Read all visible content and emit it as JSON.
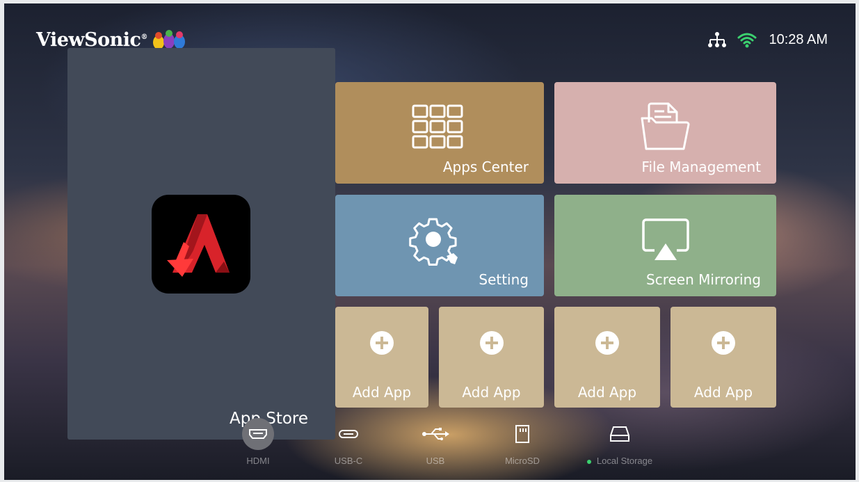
{
  "brand": {
    "logo_text": "ViewSonic",
    "registered": "®"
  },
  "status_bar": {
    "network_icon": "network-icon",
    "wifi_icon": "wifi-icon",
    "time": "10:28 AM",
    "accent_color": "#3bd16f"
  },
  "preview_panel": {
    "app_icon": "app-store-icon",
    "title": "App Store"
  },
  "tiles": {
    "apps_center": {
      "label": "Apps Center",
      "icon": "grid-icon",
      "color": "#b08e5c"
    },
    "file_management": {
      "label": "File Management",
      "icon": "folder-icon",
      "color": "#d6b0ae"
    },
    "setting": {
      "label": "Setting",
      "icon": "gear-icon",
      "color": "#6f95b1"
    },
    "screen_mirroring": {
      "label": "Screen Mirroring",
      "icon": "airplay-icon",
      "color": "#8fb08a"
    },
    "add_app": [
      {
        "label": "Add App",
        "icon": "plus-circle-icon"
      },
      {
        "label": "Add App",
        "icon": "plus-circle-icon"
      },
      {
        "label": "Add App",
        "icon": "plus-circle-icon"
      },
      {
        "label": "Add App",
        "icon": "plus-circle-icon"
      }
    ]
  },
  "sources": [
    {
      "label": "HDMI",
      "icon": "hdmi-icon",
      "selected": true
    },
    {
      "label": "USB-C",
      "icon": "usb-c-icon"
    },
    {
      "label": "USB",
      "icon": "usb-icon"
    },
    {
      "label": "MicroSD",
      "icon": "sd-card-icon"
    },
    {
      "label": "Local Storage",
      "icon": "hard-drive-icon",
      "indicator_color": "#3bd16f"
    }
  ]
}
